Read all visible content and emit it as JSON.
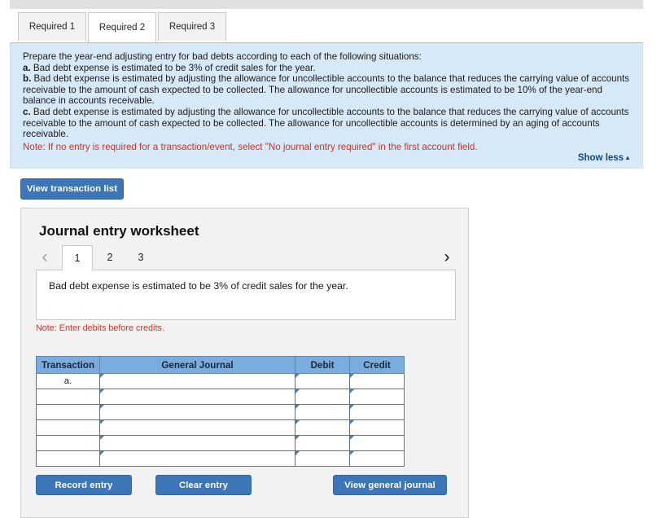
{
  "tabs": [
    {
      "label": "Required 1",
      "active": false
    },
    {
      "label": "Required 2",
      "active": true
    },
    {
      "label": "Required 3",
      "active": false
    }
  ],
  "instructions": {
    "intro": "Prepare the year-end adjusting entry for bad debts according to each of the following situations:",
    "items": [
      {
        "marker": "a.",
        "text": " Bad debt expense is estimated to be 3% of credit sales for the year."
      },
      {
        "marker": "b.",
        "text": " Bad debt expense is estimated by adjusting the allowance for uncollectible accounts to the balance that reduces the carrying value of accounts receivable to the amount of cash expected to be collected. The allowance for uncollectible accounts is estimated to be 10% of the year-end balance in accounts receivable."
      },
      {
        "marker": "c.",
        "text": " Bad debt expense is estimated by adjusting the allowance for uncollectible accounts to the balance that reduces the carrying value of accounts receivable to the amount of cash expected to be collected. The allowance for uncollectible accounts is determined by an aging of accounts receivable."
      }
    ],
    "note": "Note: If no entry is required for a transaction/event, select \"No journal entry required\" in the first account field.",
    "show_less_label": "Show less",
    "show_less_caret": "▲"
  },
  "toolbar": {
    "view_transaction_list_label": "View transaction list"
  },
  "worksheet": {
    "title": "Journal entry worksheet",
    "pager": {
      "prev_glyph": "‹",
      "next_glyph": "›",
      "pages": [
        {
          "label": "1",
          "active": true
        },
        {
          "label": "2",
          "active": false
        },
        {
          "label": "3",
          "active": false
        }
      ]
    },
    "description": "Bad debt expense is estimated to be 3% of credit sales for the year.",
    "debits_note": "Note: Enter debits before credits.",
    "table": {
      "headers": [
        "Transaction",
        "General Journal",
        "Debit",
        "Credit"
      ],
      "rows": [
        {
          "transaction": "a.",
          "general_journal": "",
          "debit": "",
          "credit": ""
        },
        {
          "transaction": "",
          "general_journal": "",
          "debit": "",
          "credit": ""
        },
        {
          "transaction": "",
          "general_journal": "",
          "debit": "",
          "credit": ""
        },
        {
          "transaction": "",
          "general_journal": "",
          "debit": "",
          "credit": ""
        },
        {
          "transaction": "",
          "general_journal": "",
          "debit": "",
          "credit": ""
        },
        {
          "transaction": "",
          "general_journal": "",
          "debit": "",
          "credit": ""
        }
      ]
    },
    "buttons": {
      "record_entry_label": "Record entry",
      "clear_entry_label": "Clear entry",
      "view_general_journal_label": "View general journal"
    }
  },
  "colors": {
    "accent_blue": "#3d76b8",
    "panel_blue": "#d7e8f7",
    "table_header_blue": "#7aaddd",
    "note_red": "#c0392b",
    "link_blue": "#13477d"
  }
}
